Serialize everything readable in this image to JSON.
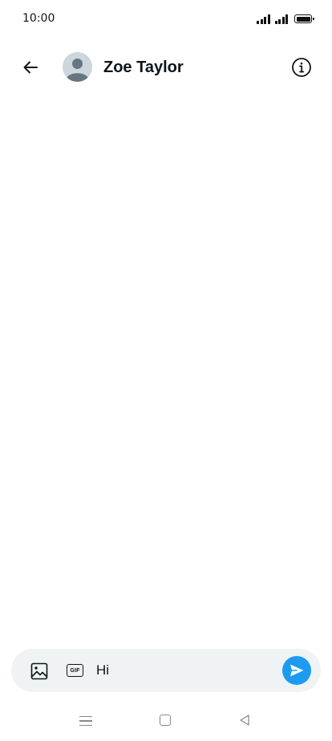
{
  "status_bar": {
    "time": "10:00",
    "icons": [
      "signal-icon",
      "signal-icon",
      "battery-icon"
    ]
  },
  "header": {
    "back_icon": "arrow-left-icon",
    "avatar_icon": "default-avatar-icon",
    "contact_name": "Zoe Taylor",
    "info_icon": "info-circle-icon"
  },
  "composer": {
    "media_icon": "image-icon",
    "gif_label": "GIF",
    "message_value": "Hi",
    "send_icon": "send-icon",
    "send_color": "#1d9bf0",
    "background_color": "#eff3f4"
  },
  "nav_bar": {
    "icons": [
      "menu-icon",
      "home-square-icon",
      "back-triangle-icon"
    ]
  }
}
